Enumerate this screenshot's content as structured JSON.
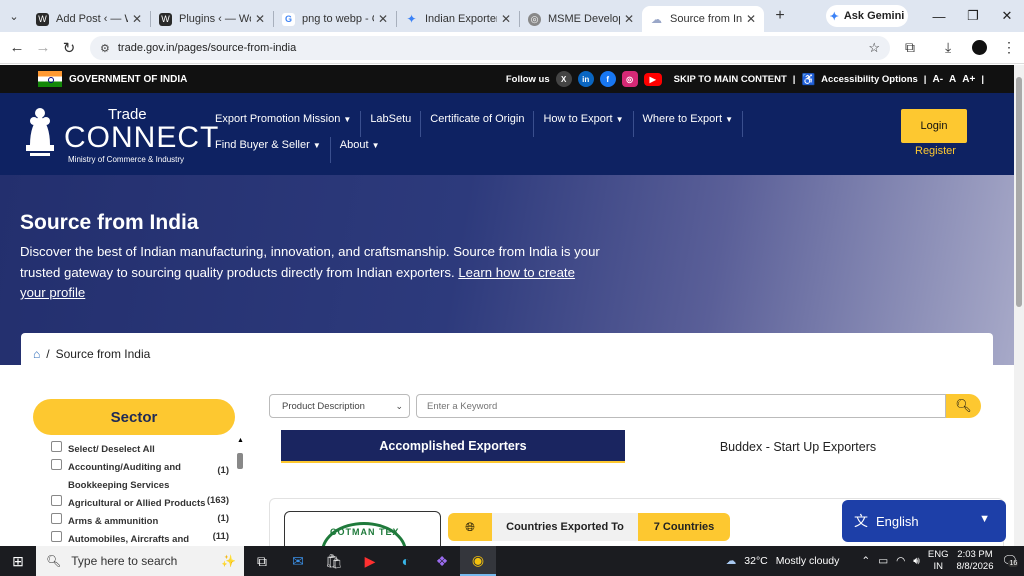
{
  "browser": {
    "tabs": [
      {
        "title": "Add Post ‹ — Wo",
        "favicon": "wordpress-icon",
        "color": "#3a3a3a",
        "active": false
      },
      {
        "title": "Plugins ‹ — Word",
        "favicon": "wordpress-icon",
        "color": "#3a3a3a",
        "active": false
      },
      {
        "title": "png to webp - Go",
        "favicon": "google-icon",
        "color": "#4285f4",
        "active": false
      },
      {
        "title": "Indian Exporter D",
        "favicon": "gemini-icon",
        "color": "#3b82f6",
        "active": false
      },
      {
        "title": "MSME Developm",
        "favicon": "globe-icon",
        "color": "#777777",
        "active": false
      },
      {
        "title": "Source from Indi",
        "favicon": "cloud-icon",
        "color": "#9aa7c8",
        "active": true
      }
    ],
    "ask_gemini": "Ask Gemini",
    "url": "trade.gov.in/pages/source-from-india"
  },
  "gov_bar": {
    "label": "GOVERNMENT OF INDIA",
    "follow_us": "Follow us",
    "skip": "SKIP TO MAIN CONTENT",
    "sep": "|",
    "accessibility": "Accessibility Options",
    "font_small": "A-",
    "font_normal": "A",
    "font_large": "A+"
  },
  "header": {
    "brand_top": "Trade",
    "brand_main": "CONNECT",
    "ministry": "Ministry of Commerce & Industry",
    "nav": [
      {
        "label": "Export Promotion Mission",
        "dropdown": true
      },
      {
        "label": "LabSetu",
        "dropdown": false
      },
      {
        "label": "Certificate of Origin",
        "dropdown": false
      },
      {
        "label": "How to Export",
        "dropdown": true
      },
      {
        "label": "Where to Export",
        "dropdown": true
      },
      {
        "label": "Find Buyer & Seller",
        "dropdown": true
      },
      {
        "label": "About",
        "dropdown": true
      }
    ],
    "login": "Login",
    "register": "Register"
  },
  "hero": {
    "title": "Source from India",
    "description": "Discover the best of Indian manufacturing, innovation, and craftsmanship. Source from India is your trusted gateway to sourcing quality products directly from Indian exporters.",
    "link": "Learn how to create your profile"
  },
  "breadcrumb": {
    "sep": "/",
    "current": "Source from India"
  },
  "sidebar": {
    "title": "Sector",
    "items": [
      {
        "label": "Select/ Deselect All",
        "count": ""
      },
      {
        "label": "Accounting/Auditing and Bookkeeping Services",
        "count": "(1)"
      },
      {
        "label": "Agricultural or Allied Products",
        "count": "(163)"
      },
      {
        "label": "Arms & ammunition",
        "count": "(1)"
      },
      {
        "label": "Automobiles, Aircrafts and other",
        "count": "(11)"
      }
    ]
  },
  "search": {
    "select_value": "Product Description",
    "keyword_placeholder": "Enter a Keyword"
  },
  "tabs": {
    "accomplished": "Accomplished Exporters",
    "buddex": "Buddex - Start Up Exporters"
  },
  "card": {
    "logo_text": "COTMAN TEX",
    "countries_label": "Countries Exported To",
    "countries_value": "7 Countries"
  },
  "language": {
    "label": "English"
  },
  "taskbar": {
    "search_placeholder": "Type here to search",
    "weather_temp": "32°C",
    "weather_text": "Mostly cloudy",
    "lang_top": "ENG",
    "lang_bottom": "IN",
    "time": "2:03 PM",
    "date": "8/8/2026",
    "notif_count": "16"
  }
}
